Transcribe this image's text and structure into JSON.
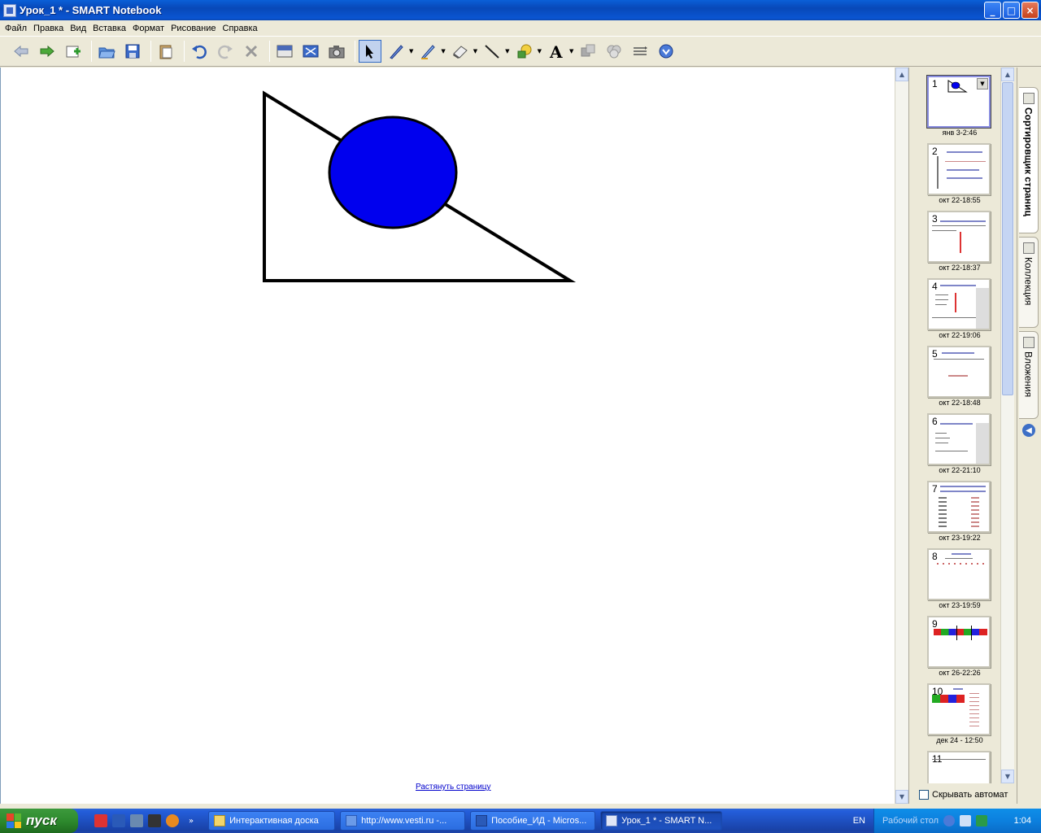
{
  "window": {
    "title": "Урок_1 * - SMART Notebook",
    "buttons": {
      "minimize": "_",
      "maximize": "□",
      "close": "×"
    }
  },
  "menu": [
    "Файл",
    "Правка",
    "Вид",
    "Вставка",
    "Формат",
    "Рисование",
    "Справка"
  ],
  "toolbar": {
    "icons": [
      "back-icon",
      "forward-icon",
      "add-page-icon",
      "open-icon",
      "save-icon",
      "paste-icon",
      "undo-icon",
      "redo-icon",
      "delete-icon",
      "screen-shade-icon",
      "full-screen-icon",
      "capture-icon",
      "select-icon",
      "pen-icon",
      "creative-pen-icon",
      "eraser-icon",
      "line-icon",
      "shape-icon",
      "text-icon",
      "fill-icon",
      "properties-icon",
      "table-icon",
      "more-icon"
    ]
  },
  "canvas": {
    "stretch_link": "Растянуть страницу",
    "shapes": {
      "circle_fill": "#0000ee",
      "stroke": "#000000"
    }
  },
  "page_sorter": {
    "pages": [
      {
        "num": "1",
        "caption": "янв 3-2:46",
        "selected": true
      },
      {
        "num": "2",
        "caption": "окт 22-18:55"
      },
      {
        "num": "3",
        "caption": "окт 22-18:37"
      },
      {
        "num": "4",
        "caption": "окт 22-19:06"
      },
      {
        "num": "5",
        "caption": "окт 22-18:48"
      },
      {
        "num": "6",
        "caption": "окт 22-21:10"
      },
      {
        "num": "7",
        "caption": "окт 23-19:22"
      },
      {
        "num": "8",
        "caption": "окт 23-19:59"
      },
      {
        "num": "9",
        "caption": "окт 26-22:26"
      },
      {
        "num": "10",
        "caption": "дек 24 - 12:50"
      },
      {
        "num": "11",
        "caption": ""
      }
    ],
    "autohide_label": "Скрывать автомат"
  },
  "side_tabs": [
    {
      "label": "Сортировщик страниц",
      "active": true
    },
    {
      "label": "Коллекция"
    },
    {
      "label": "Вложения"
    }
  ],
  "taskbar": {
    "start": "пуск",
    "tasks": [
      {
        "label": "Интерактивная доска"
      },
      {
        "label": "http://www.vesti.ru -..."
      },
      {
        "label": "Пособие_ИД - Micros..."
      },
      {
        "label": "Урок_1 * - SMART N...",
        "active": true
      }
    ],
    "lang": "EN",
    "desktop": "Рабочий стол",
    "clock": "1:04"
  }
}
